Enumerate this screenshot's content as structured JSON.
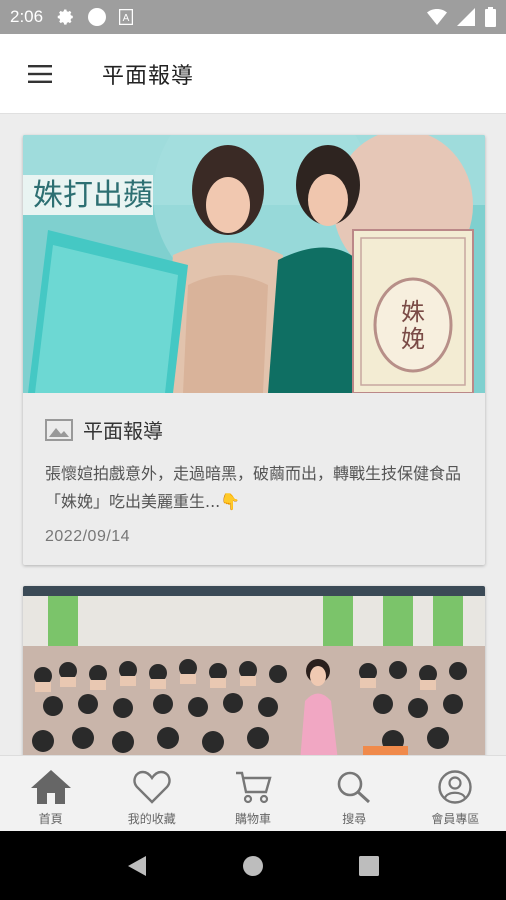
{
  "status_bar": {
    "time": "2:06",
    "icons": [
      "gear-icon",
      "circle-icon",
      "a-badge-icon",
      "wifi-icon",
      "signal-icon",
      "battery-icon"
    ]
  },
  "header": {
    "title": "平面報導",
    "menu_icon": "hamburger-menu-icon"
  },
  "articles": [
    {
      "category": "平面報導",
      "excerpt": "張懷媗拍戲意外，走過暗黑，破繭而出，轉戰生技保健食品「姝娩」吃出美麗重生...👇",
      "date": "2022/09/14"
    },
    {
      "category": "",
      "excerpt": "",
      "date": ""
    }
  ],
  "bottom_nav": [
    {
      "label": "首頁",
      "icon": "home-icon",
      "active": true
    },
    {
      "label": "我的收藏",
      "icon": "heart-icon",
      "active": false
    },
    {
      "label": "購物車",
      "icon": "cart-icon",
      "active": false
    },
    {
      "label": "搜尋",
      "icon": "search-icon",
      "active": false
    },
    {
      "label": "會員專區",
      "icon": "account-icon",
      "active": false
    }
  ],
  "colors": {
    "status_bar": "#9e9e9e",
    "app_bar": "#ffffff",
    "background": "#ededed",
    "nav_icon": "#777777",
    "active_icon": "#666666"
  }
}
